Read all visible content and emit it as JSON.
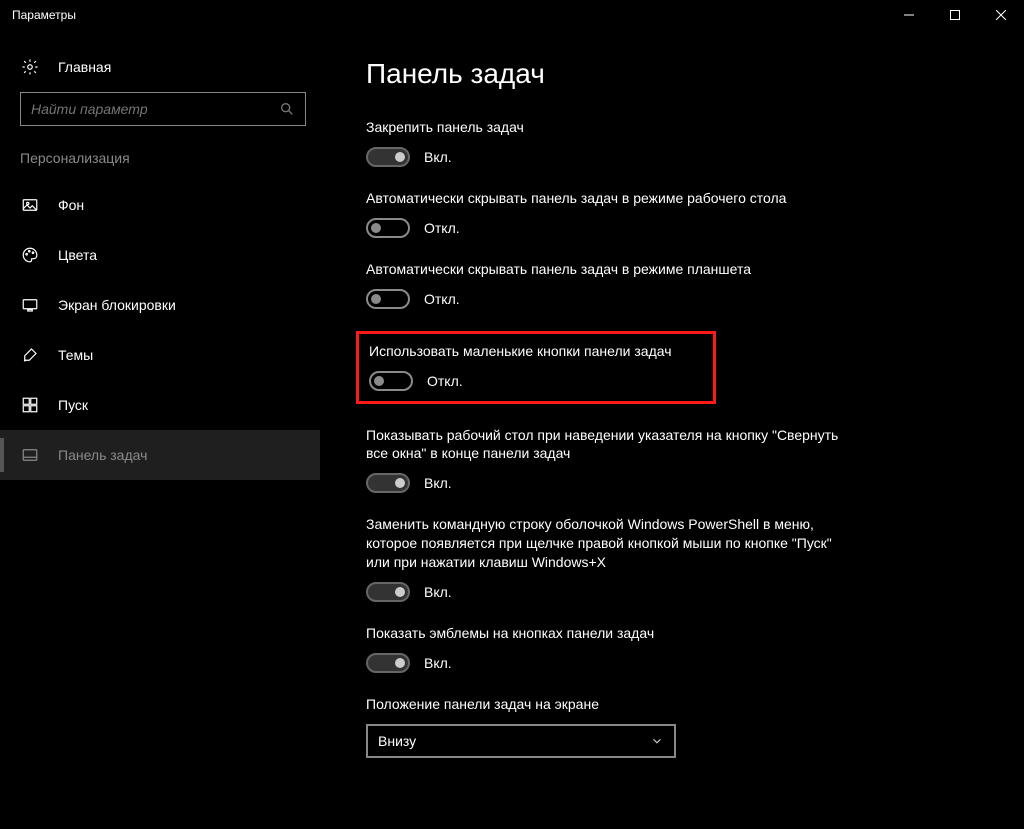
{
  "window": {
    "title": "Параметры"
  },
  "sidebar": {
    "home": "Главная",
    "search_placeholder": "Найти параметр",
    "category": "Персонализация",
    "items": [
      {
        "label": "Фон"
      },
      {
        "label": "Цвета"
      },
      {
        "label": "Экран блокировки"
      },
      {
        "label": "Темы"
      },
      {
        "label": "Пуск"
      },
      {
        "label": "Панель задач"
      }
    ]
  },
  "content": {
    "title": "Панель задач",
    "label_on": "Вкл.",
    "label_off": "Откл.",
    "settings": [
      {
        "desc": "Закрепить панель задач",
        "state": "on"
      },
      {
        "desc": "Автоматически скрывать панель задач в режиме рабочего стола",
        "state": "off"
      },
      {
        "desc": "Автоматически скрывать панель задач в режиме планшета",
        "state": "off"
      },
      {
        "desc": "Использовать маленькие кнопки панели задач",
        "state": "off"
      },
      {
        "desc": "Показывать рабочий стол при наведении указателя на кнопку \"Свернуть все окна\" в конце панели задач",
        "state": "on"
      },
      {
        "desc": "Заменить командную строку оболочкой Windows PowerShell в меню, которое появляется при щелчке правой кнопкой мыши по кнопке \"Пуск\" или при нажатии клавиш Windows+X",
        "state": "on"
      },
      {
        "desc": "Показать эмблемы на кнопках панели задач",
        "state": "on"
      }
    ],
    "position": {
      "label": "Положение панели задач на экране",
      "value": "Внизу"
    }
  }
}
